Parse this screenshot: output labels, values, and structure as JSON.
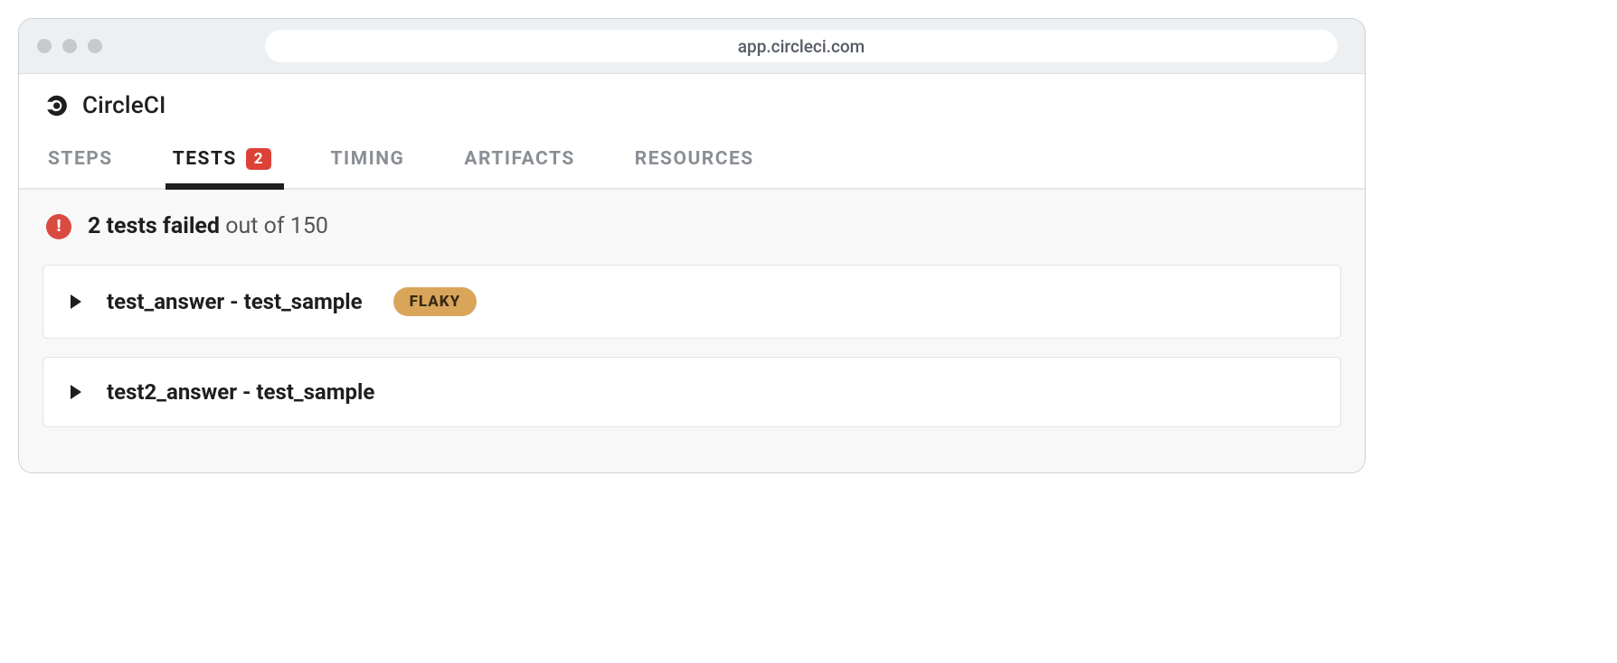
{
  "browser": {
    "url": "app.circleci.com"
  },
  "brand": "CircleCI",
  "tabs": [
    {
      "label": "STEPS"
    },
    {
      "label": "TESTS",
      "badge": "2",
      "active": true
    },
    {
      "label": "TIMING"
    },
    {
      "label": "ARTIFACTS"
    },
    {
      "label": "RESOURCES"
    }
  ],
  "summary": {
    "bold": "2 tests failed",
    "rest": " out of 150"
  },
  "tests": [
    {
      "name": "test_answer - test_sample",
      "flaky": "FLAKY"
    },
    {
      "name": "test2_answer - test_sample"
    }
  ]
}
